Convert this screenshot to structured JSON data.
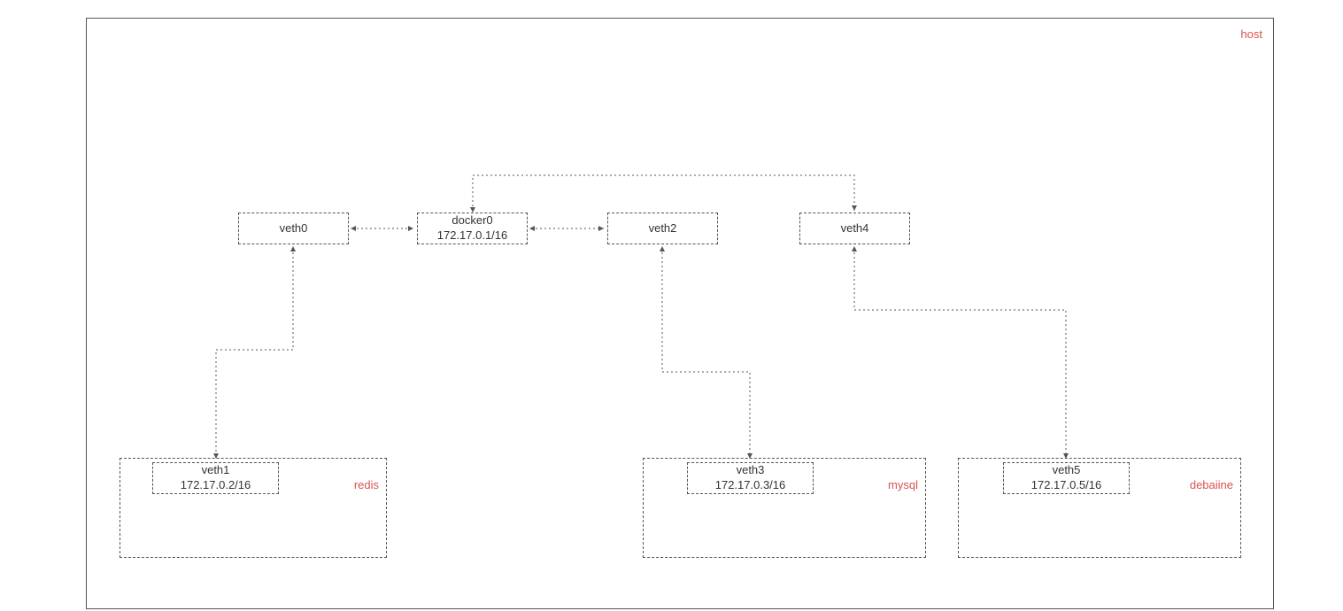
{
  "host": {
    "label": "host"
  },
  "bridge": {
    "name": "docker0",
    "ip": "172.17.0.1/16"
  },
  "veths_host": {
    "veth0": "veth0",
    "veth2": "veth2",
    "veth4": "veth4"
  },
  "containers": {
    "redis": {
      "label": "redis",
      "veth_name": "veth1",
      "veth_ip": "172.17.0.2/16"
    },
    "mysql": {
      "label": "mysql",
      "veth_name": "veth3",
      "veth_ip": "172.17.0.3/16"
    },
    "debaiine": {
      "label": "debaiine",
      "veth_name": "veth5",
      "veth_ip": "172.17.0.5/16"
    }
  }
}
